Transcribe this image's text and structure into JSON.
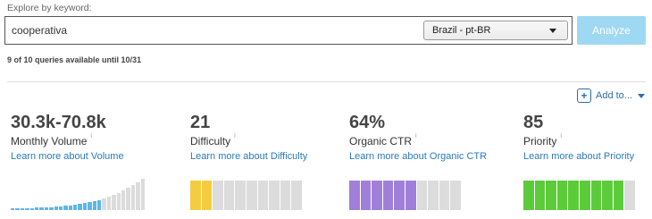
{
  "search": {
    "label": "Explore by keyword:",
    "value": "cooperativa",
    "locale": "Brazil - pt-BR",
    "analyze_label": "Analyze",
    "quota_text": "9 of 10 queries available until 10/31"
  },
  "toolbar": {
    "add_to_label": "Add to...",
    "add_to_icon": "plus-box-icon"
  },
  "metrics": [
    {
      "value": "30.3k-70.8k",
      "label": "Monthly Volume",
      "info": "i",
      "learn_more": "Learn more about Volume",
      "visual": "volume-bars",
      "filled_color": "#5fb7e8",
      "empty_color": "#dcdcdc"
    },
    {
      "value": "21",
      "label": "Difficulty",
      "info": "i",
      "learn_more": "Learn more about Difficulty",
      "visual": "segments",
      "score": 21,
      "filled_color": "#f5cc3f",
      "empty_color": "#dcdcdc"
    },
    {
      "value": "64%",
      "label": "Organic CTR",
      "info": "i",
      "learn_more": "Learn more about Organic CTR",
      "visual": "segments",
      "score": 64,
      "filled_color": "#a07fda",
      "empty_color": "#dcdcdc"
    },
    {
      "value": "85",
      "label": "Priority",
      "info": "i",
      "learn_more": "Learn more about Priority",
      "visual": "segments",
      "score": 85,
      "filled_color": "#5ccb3a",
      "empty_color": "#dcdcdc"
    }
  ]
}
